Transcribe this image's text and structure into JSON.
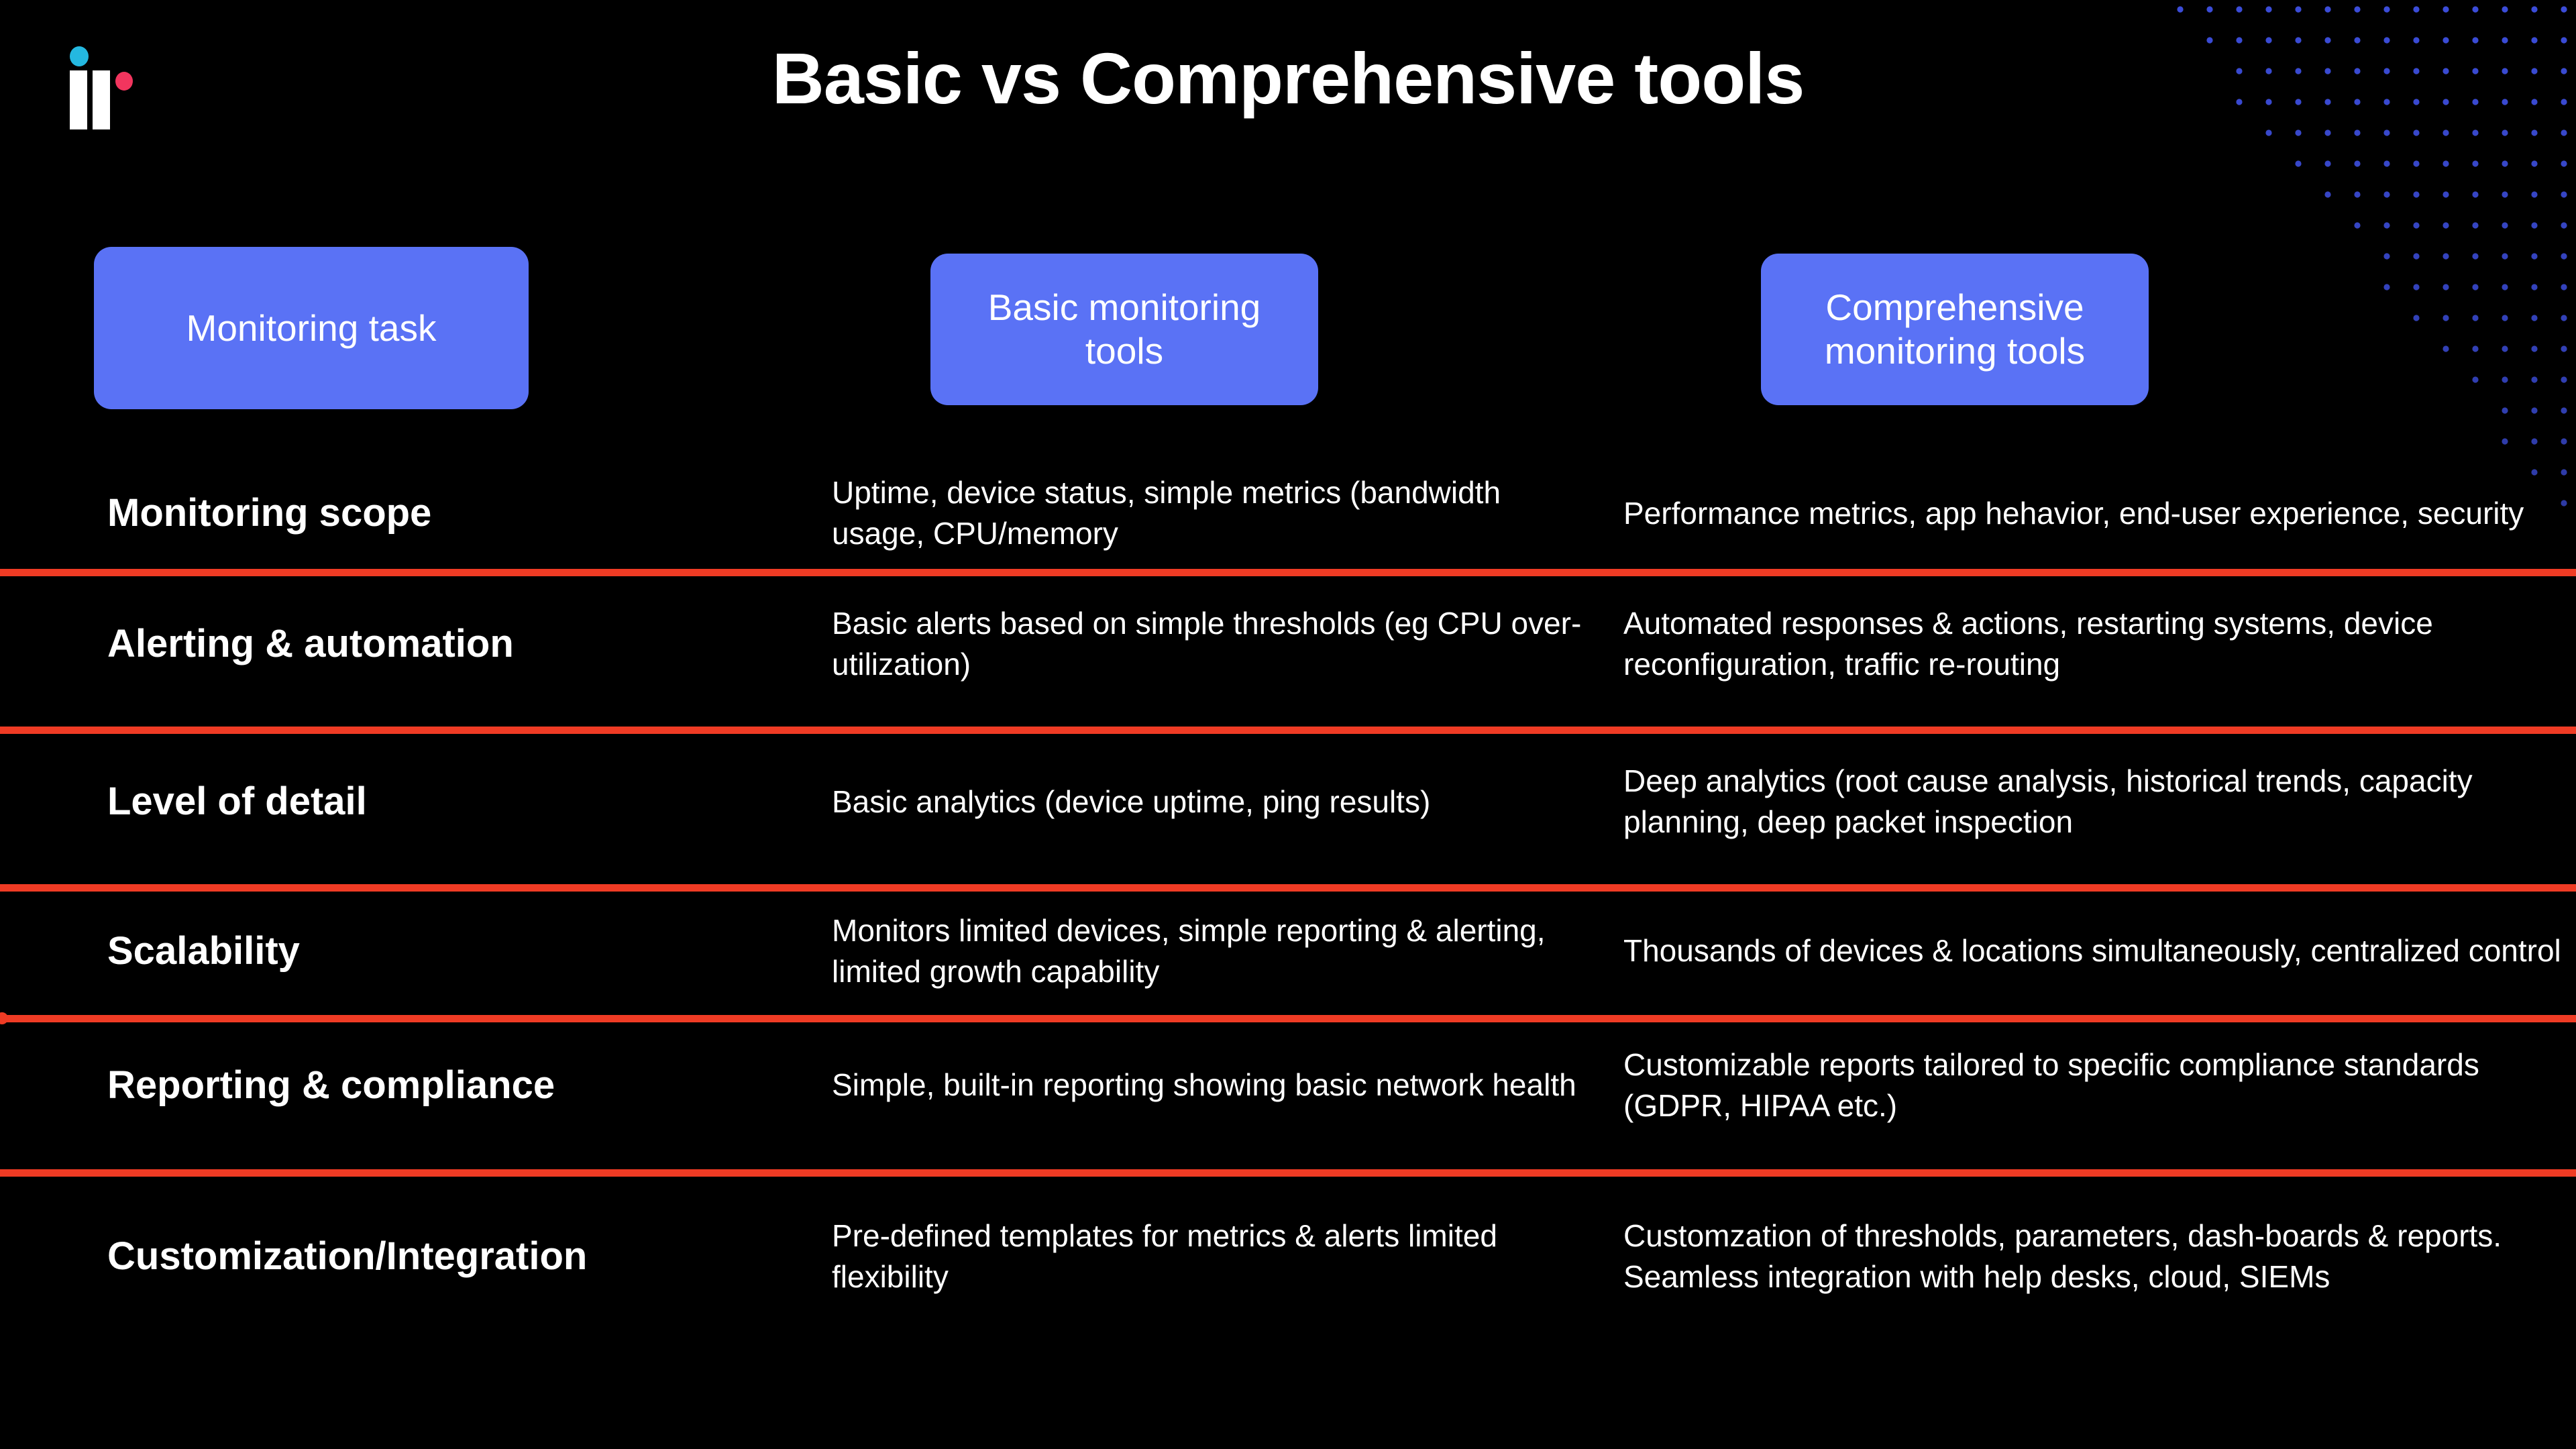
{
  "title": "Basic vs Comprehensive tools",
  "colors": {
    "background": "#000000",
    "pill": "#5a72f5",
    "divider": "#ef3b24",
    "logo_cyan": "#24b8e0",
    "logo_pink": "#f2355e",
    "dot_field": "#3b4cd8",
    "text": "#ffffff"
  },
  "logo": {
    "name": "ii-logo"
  },
  "headers": {
    "task": "Monitoring task",
    "basic": "Basic monitoring\ntools",
    "comprehensive": "Comprehensive\nmonitoring tools"
  },
  "rows": [
    {
      "label": "Monitoring scope",
      "basic": "Uptime, device status, simple metrics (bandwidth usage, CPU/memory",
      "comprehensive": "Performance metrics, app hehavior, end-user experience, security"
    },
    {
      "label": "Alerting & automation",
      "basic": "Basic alerts based on simple thresholds (eg CPU over-utilization)",
      "comprehensive": "Automated responses & actions, restarting systems, device reconfiguration, traffic re-routing"
    },
    {
      "label": "Level of detail",
      "basic": "Basic analytics (device uptime, ping results)",
      "comprehensive": "Deep analytics (root cause analysis, historical trends, capacity planning, deep packet inspection"
    },
    {
      "label": "Scalability",
      "basic": "Monitors limited devices, simple reporting & alerting, limited growth capability",
      "comprehensive": "Thousands of devices & locations simultaneously, centralized control"
    },
    {
      "label": "Reporting & compliance",
      "basic": "Simple, built-in reporting showing basic network health",
      "comprehensive": "Customizable reports tailored to  specific compliance standards (GDPR, HIPAA etc.)"
    },
    {
      "label": "Customization/Integration",
      "basic": "Pre-defined templates for metrics & alerts limited flexibility",
      "comprehensive": "Customzation of thresholds, parameters, dash-boards & reports. Seamless integration with help desks, cloud, SIEMs"
    }
  ]
}
